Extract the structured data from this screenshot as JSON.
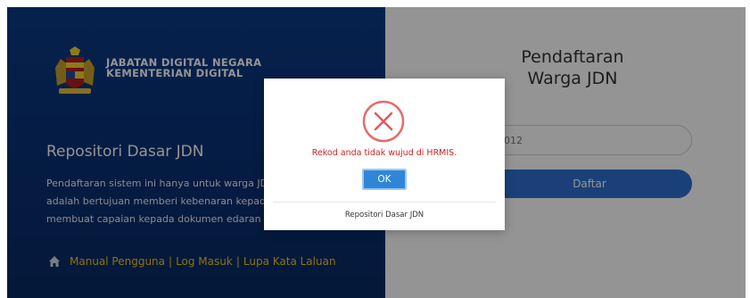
{
  "brand": {
    "agency_line1": "JABATAN DIGITAL NEGARA",
    "agency_line2": "KEMENTERIAN DIGITAL",
    "logo_icon": "coat-of-arms-icon"
  },
  "left": {
    "title": "Repositori Dasar JDN",
    "desc_lines": [
      "Pendaftaran sistem ini hanya untuk warga JDN",
      "adalah bertujuan memberi kebenaran kepada",
      "membuat capaian kepada dokumen edaran da"
    ],
    "links": {
      "icon": "home-icon",
      "manual": "Manual Pengguna",
      "sep1": "|",
      "login": "Log Masuk",
      "sep2": "|",
      "forgot": "Lupa Kata Laluan"
    }
  },
  "form": {
    "title_line1": "Pendaftaran",
    "title_line2": "Warga JDN",
    "id_value": "012",
    "submit_label": "Daftar"
  },
  "modal": {
    "icon": "error-x-icon",
    "message": "Rekod anda tidak wujud di HRMIS.",
    "ok_label": "OK",
    "footer": "Repositori Dasar JDN"
  },
  "colors": {
    "panel_blue": "#0b3a86",
    "link_yellow": "#f5c518",
    "button_blue": "#2f6fd1",
    "error_red": "#d22020"
  }
}
